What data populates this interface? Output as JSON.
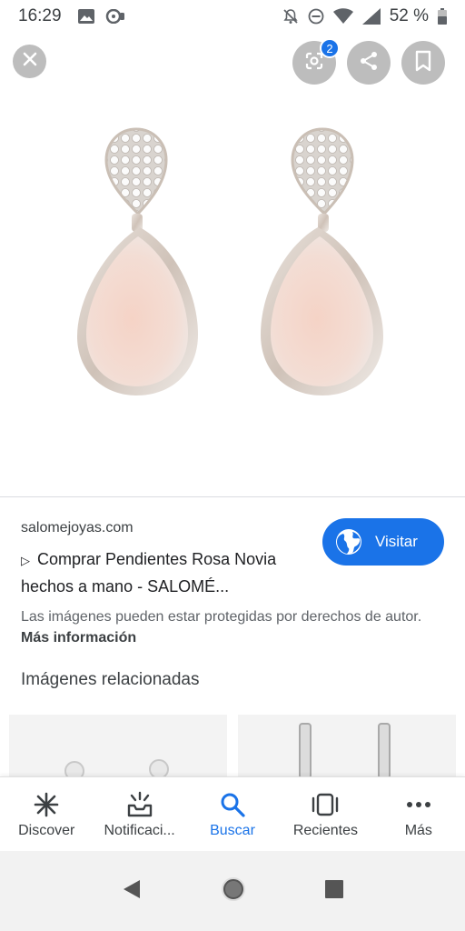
{
  "status_bar": {
    "time": "16:29",
    "battery_text": "52 %",
    "icons": [
      "image-icon",
      "assistant-icon",
      "notifications-off-icon",
      "do-not-disturb-icon",
      "wifi-icon",
      "signal-icon",
      "battery-icon"
    ]
  },
  "viewer": {
    "close_icon": "close-icon",
    "lens_badge_count": "2",
    "actions": [
      "lens-icon",
      "share-icon",
      "bookmark-icon"
    ]
  },
  "result": {
    "source": "salomejoyas.com",
    "title": "Comprar Pendientes Rosa Novia hechos a mano - SALOMÉ...",
    "visit_label": "Visitar",
    "copyright_text": "Las imágenes pueden estar protegidas por derechos de autor.",
    "more_info_label": "Más información",
    "related_title": "Imágenes relacionadas"
  },
  "bottom_nav": {
    "items": [
      {
        "label": "Discover",
        "icon": "asterisk-icon"
      },
      {
        "label": "Notificaci...",
        "icon": "updates-icon"
      },
      {
        "label": "Buscar",
        "icon": "search-icon"
      },
      {
        "label": "Recientes",
        "icon": "recent-tabs-icon"
      },
      {
        "label": "Más",
        "icon": "more-icon"
      }
    ],
    "active_index": 2
  },
  "system_nav": [
    "back-icon",
    "home-icon",
    "overview-icon"
  ],
  "colors": {
    "accent": "#1a73e8",
    "button_gray": "#bdbdbd",
    "stone_pink": "#f2d8cf"
  }
}
